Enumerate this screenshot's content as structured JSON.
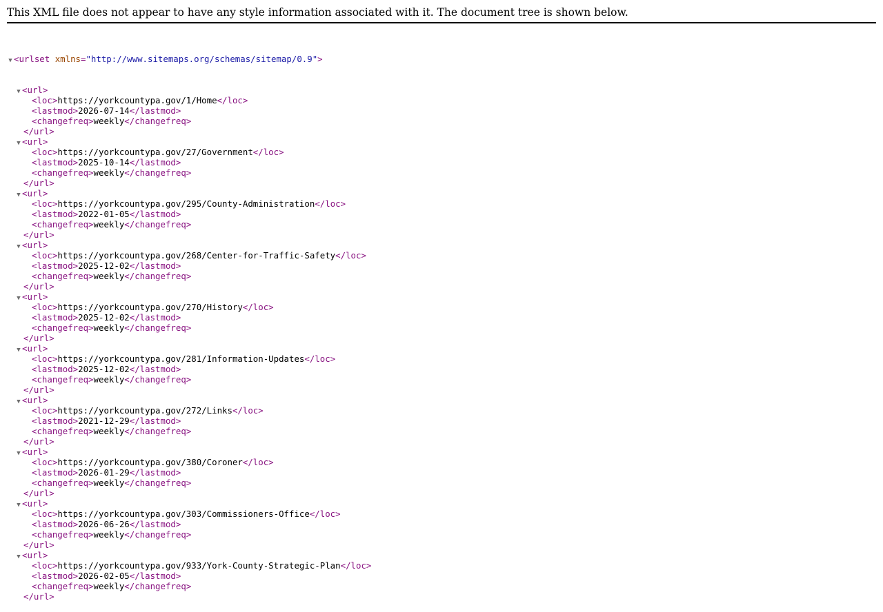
{
  "notice": "This XML file does not appear to have any style information associated with it. The document tree is shown below.",
  "root": {
    "open_prefix": "<urlset ",
    "attr_name": "xmlns",
    "attr_eq": "=",
    "attr_value": "\"http://www.sitemaps.org/schemas/sitemap/0.9\"",
    "open_suffix": ">",
    "toggle_glyph": "▼"
  },
  "tags": {
    "url_open": "<url>",
    "url_close": "</url>",
    "loc_open": "<loc>",
    "loc_close": "</loc>",
    "lastmod_open": "<lastmod>",
    "lastmod_close": "</lastmod>",
    "changefreq_open": "<changefreq>",
    "changefreq_close": "</changefreq>"
  },
  "urls": [
    {
      "loc": "https://yorkcountypa.gov/1/Home",
      "lastmod": "2026-07-14",
      "changefreq": "weekly"
    },
    {
      "loc": "https://yorkcountypa.gov/27/Government",
      "lastmod": "2025-10-14",
      "changefreq": "weekly"
    },
    {
      "loc": "https://yorkcountypa.gov/295/County-Administration",
      "lastmod": "2022-01-05",
      "changefreq": "weekly"
    },
    {
      "loc": "https://yorkcountypa.gov/268/Center-for-Traffic-Safety",
      "lastmod": "2025-12-02",
      "changefreq": "weekly"
    },
    {
      "loc": "https://yorkcountypa.gov/270/History",
      "lastmod": "2025-12-02",
      "changefreq": "weekly"
    },
    {
      "loc": "https://yorkcountypa.gov/281/Information-Updates",
      "lastmod": "2025-12-02",
      "changefreq": "weekly"
    },
    {
      "loc": "https://yorkcountypa.gov/272/Links",
      "lastmod": "2021-12-29",
      "changefreq": "weekly"
    },
    {
      "loc": "https://yorkcountypa.gov/380/Coroner",
      "lastmod": "2026-01-29",
      "changefreq": "weekly"
    },
    {
      "loc": "https://yorkcountypa.gov/303/Commissioners-Office",
      "lastmod": "2026-06-26",
      "changefreq": "weekly"
    },
    {
      "loc": "https://yorkcountypa.gov/933/York-County-Strategic-Plan",
      "lastmod": "2026-02-05",
      "changefreq": "weekly"
    }
  ]
}
